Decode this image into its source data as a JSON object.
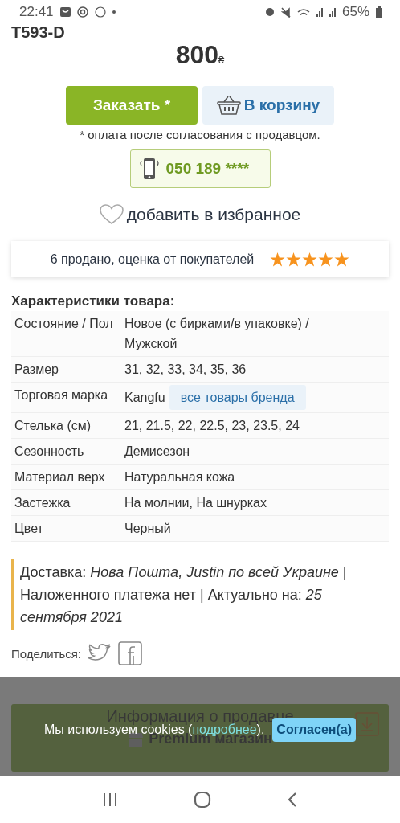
{
  "status_bar": {
    "time": "22:41",
    "battery": "65%"
  },
  "product": {
    "code": "T593-D",
    "price": "800",
    "currency": "₴",
    "order_button": "Заказать *",
    "cart_button": "В корзину",
    "payment_note": "* оплата после согласования с продавцом.",
    "phone": "050 189 ****",
    "favorite": "добавить в избранное"
  },
  "rating": {
    "text": "6 продано, оценка от покупателей",
    "stars": 5
  },
  "specs": {
    "title": "Характеристики товара:",
    "rows": [
      {
        "label": "Состояние / Пол",
        "value": "Новое (с бирками/в упаковке) / Мужской"
      },
      {
        "label": "Размер",
        "value": "31, 32, 33, 34, 35, 36"
      },
      {
        "label": "Торговая марка",
        "value": "Kangfu",
        "link": "все товары бренда"
      },
      {
        "label": "Стелька (см)",
        "value": "21, 21.5, 22, 22.5, 23, 23.5, 24"
      },
      {
        "label": "Сезонность",
        "value": "Демисезон"
      },
      {
        "label": "Материал верх",
        "value": "Натуральная кожа"
      },
      {
        "label": "Застежка",
        "value": "На молнии, На шнурках"
      },
      {
        "label": "Цвет",
        "value": "Черный"
      }
    ]
  },
  "delivery": "Доставка: *Нова Пошта, Justin по всей Украине* | Наложенного платежа нет | Актуально на: *25 сентября 2021*",
  "share_label": "Поделиться:",
  "seller": {
    "title": "Информация о продавце",
    "badge": "Premium магазин"
  },
  "cookie_banner": {
    "text": "Мы используем cookies (",
    "link": "подробнее",
    "text_end": ").",
    "button": "Согласен(а)"
  }
}
